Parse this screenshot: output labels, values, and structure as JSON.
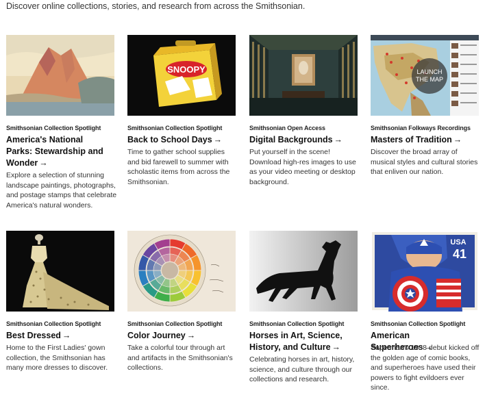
{
  "intro_text": "Discover online collections, stories, and research from across the Smithsonian.",
  "arrow_glyph": "→",
  "cards": [
    {
      "eyebrow": "Smithsonian Collection Spotlight",
      "title": "America's National Parks: Stewardship and Wonder",
      "description": "Explore a selection of stunning landscape paintings, photographs, and postage stamps that celebrate America's natural wonders.",
      "image": "desert-landscape-painting"
    },
    {
      "eyebrow": "Smithsonian Collection Spotlight",
      "title": "Back to School Days",
      "description": "Time to gather school supplies and bid farewell to summer with scholastic items from across the Smithsonian.",
      "image": "snoopy-lunchbox",
      "image_text": "SNOOPY"
    },
    {
      "eyebrow": "Smithsonian Open Access",
      "title": "Digital Backgrounds",
      "description": "Put yourself in the scene! Download high-res images to use as your video meeting or desktop background.",
      "image": "peacock-room-interior"
    },
    {
      "eyebrow": "Smithsonian Folkways Recordings",
      "title": "Masters of Tradition",
      "description": "Discover the broad array of musical styles and cultural stories that enliven our nation.",
      "image": "interactive-map",
      "image_text_line1": "LAUNCH",
      "image_text_line2": "THE MAP"
    },
    {
      "eyebrow": "Smithsonian Collection Spotlight",
      "title": "Best Dressed",
      "description": "Home to the First Ladies' gown collection, the Smithsonian has many more dresses to discover.",
      "image": "first-lady-gown"
    },
    {
      "eyebrow": "Smithsonian Collection Spotlight",
      "title": "Color Journey",
      "description": "Take a colorful tour through art and artifacts in the Smithsonian's collections.",
      "image": "color-wheel"
    },
    {
      "eyebrow": "Smithsonian Collection Spotlight",
      "title": "Horses in Art, Science, History, and Culture",
      "description": "Celebrating horses in art, history, science, and culture through our collections and research.",
      "image": "horse-weathervane"
    },
    {
      "eyebrow": "Smithsonian Collection Spotlight",
      "title": "American Superheroes",
      "description": "Superman's 1938 debut kicked off the golden age of comic books, and superheroes have used their powers to fight evildoers ever since.",
      "image": "captain-america-stamp",
      "image_text_usa": "USA",
      "image_text_value": "41"
    }
  ],
  "colors": {
    "text": "#111111",
    "muted": "#333333",
    "background": "#ffffff"
  }
}
